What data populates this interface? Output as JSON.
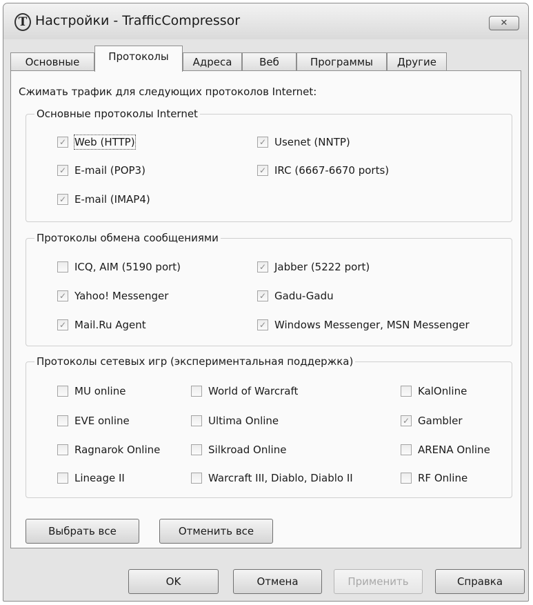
{
  "window": {
    "title": "Настройки - TrafficCompressor",
    "app_icon_glyph": "T",
    "close_glyph": "✕"
  },
  "tabs": [
    {
      "label": "Основные",
      "active": false
    },
    {
      "label": "Протоколы",
      "active": true
    },
    {
      "label": "Адреса",
      "active": false
    },
    {
      "label": "Веб",
      "active": false
    },
    {
      "label": "Программы",
      "active": false
    },
    {
      "label": "Другие",
      "active": false
    }
  ],
  "intro_text": "Сжимать трафик для следующих протоколов Internet:",
  "groups": {
    "internet": {
      "title": "Основные протоколы Internet",
      "items": [
        {
          "label": "Web (HTTP)",
          "checked": true
        },
        {
          "label": "Usenet (NNTP)",
          "checked": true
        },
        {
          "label": "E-mail (POP3)",
          "checked": true
        },
        {
          "label": "IRC (6667-6670 ports)",
          "checked": true
        },
        {
          "label": "E-mail (IMAP4)",
          "checked": true
        }
      ]
    },
    "messaging": {
      "title": "Протоколы обмена сообщениями",
      "items": [
        {
          "label": "ICQ, AIM (5190 port)",
          "checked": false
        },
        {
          "label": "Jabber (5222 port)",
          "checked": true
        },
        {
          "label": "Yahoo! Messenger",
          "checked": true
        },
        {
          "label": "Gadu-Gadu",
          "checked": true
        },
        {
          "label": "Mail.Ru Agent",
          "checked": true
        },
        {
          "label": "Windows Messenger, MSN Messenger",
          "checked": true
        }
      ]
    },
    "games": {
      "title": "Протоколы сетевых игр (экспериментальная поддержка)",
      "items": [
        {
          "label": "MU online",
          "checked": false
        },
        {
          "label": "World of Warcraft",
          "checked": false
        },
        {
          "label": "KalOnline",
          "checked": false
        },
        {
          "label": "EVE online",
          "checked": false
        },
        {
          "label": "Ultima Online",
          "checked": false
        },
        {
          "label": "Gambler",
          "checked": true
        },
        {
          "label": "Ragnarok Online",
          "checked": false
        },
        {
          "label": "Silkroad Online",
          "checked": false
        },
        {
          "label": "ARENA Online",
          "checked": false
        },
        {
          "label": "Lineage II",
          "checked": false
        },
        {
          "label": "Warcraft III, Diablo, Diablo II",
          "checked": false
        },
        {
          "label": "RF Online",
          "checked": false
        }
      ]
    }
  },
  "panel_buttons": {
    "select_all": "Выбрать все",
    "deselect_all": "Отменить все"
  },
  "footer_buttons": {
    "ok": "OK",
    "cancel": "Отмена",
    "apply": "Применить",
    "help": "Справка"
  },
  "check_glyph": "✓"
}
